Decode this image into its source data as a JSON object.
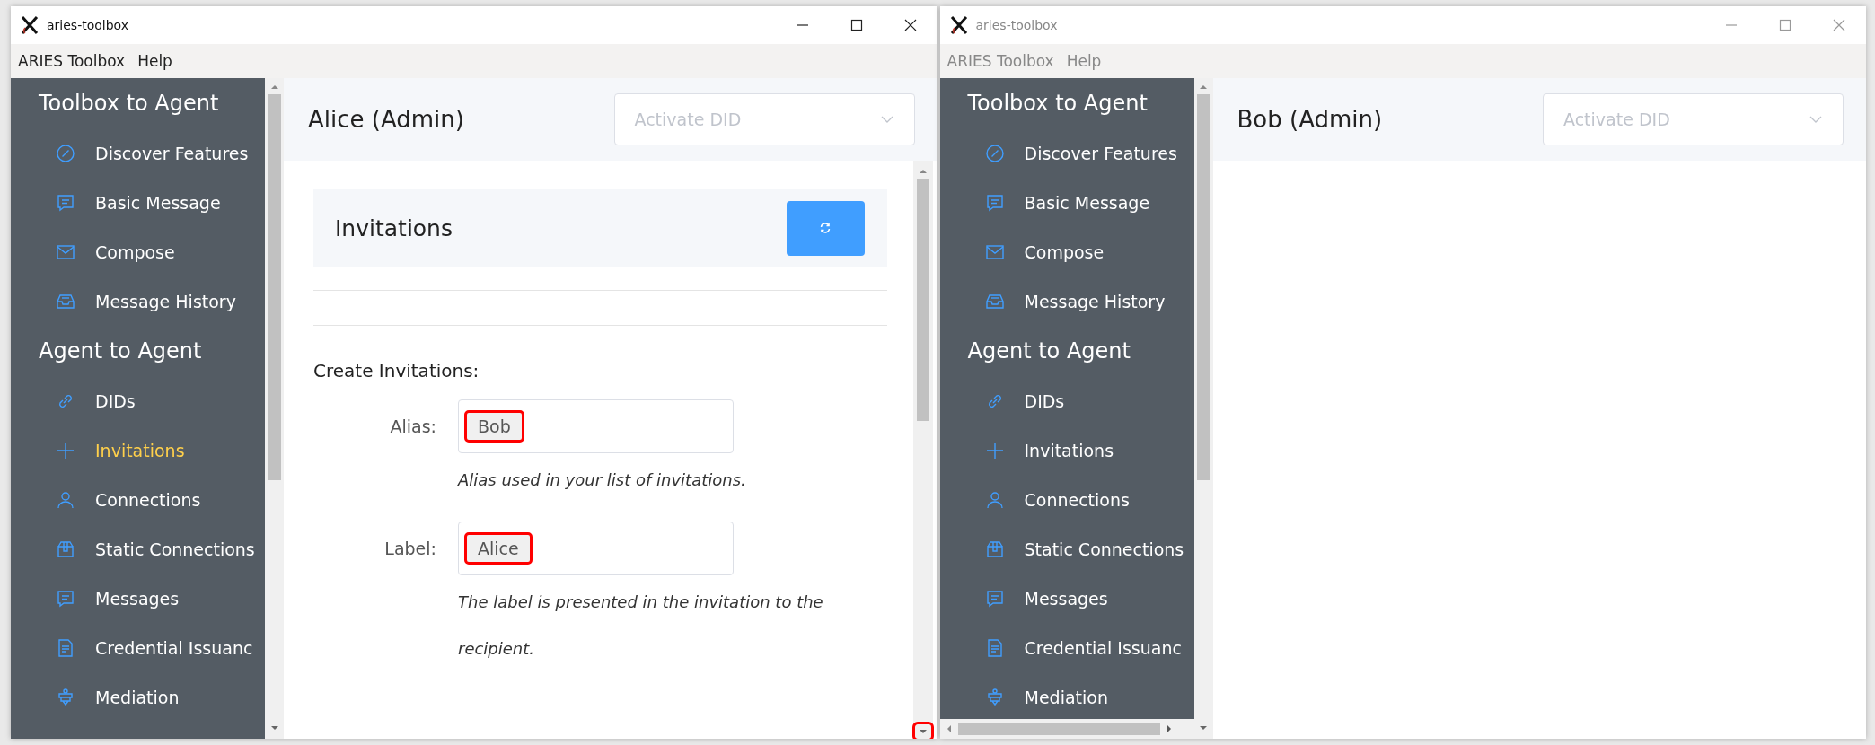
{
  "windows": [
    {
      "title": "aries-toolbox",
      "active": true,
      "menu": [
        "ARIES Toolbox",
        "Help"
      ],
      "horizontal_scrollbar": false,
      "sidebar": [
        {
          "heading": "Toolbox to Agent",
          "items": [
            {
              "label": "Discover Features",
              "kind": "compass",
              "selected": false
            },
            {
              "label": "Basic Message",
              "kind": "message",
              "selected": false
            },
            {
              "label": "Compose",
              "kind": "mail",
              "selected": false
            },
            {
              "label": "Message History",
              "kind": "inbox",
              "selected": false
            }
          ]
        },
        {
          "heading": "Agent to Agent",
          "items": [
            {
              "label": "DIDs",
              "kind": "link",
              "selected": false
            },
            {
              "label": "Invitations",
              "kind": "plus",
              "selected": true
            },
            {
              "label": "Connections",
              "kind": "user",
              "selected": false
            },
            {
              "label": "Static Connections",
              "kind": "box",
              "selected": false
            },
            {
              "label": "Messages",
              "kind": "message",
              "selected": false
            },
            {
              "label": "Credential Issuanc",
              "kind": "document",
              "selected": false
            },
            {
              "label": "Mediation",
              "kind": "mediation",
              "selected": false
            }
          ]
        }
      ],
      "agent": "Alice (Admin)",
      "did_select": {
        "placeholder": "Activate DID"
      },
      "page": {
        "title": "Invitations",
        "section_heading": "Create Invitations:",
        "scroll_arrow_highlighted": true,
        "fields": [
          {
            "label": "Alias:",
            "value": "Bob",
            "help": "Alias used in your list of invitations.",
            "highlighted": true
          },
          {
            "label": "Label:",
            "value": "Alice",
            "help": "The label is presented in the invitation to the recipient.",
            "highlighted": true
          }
        ]
      }
    },
    {
      "title": "aries-toolbox",
      "active": false,
      "menu": [
        "ARIES Toolbox",
        "Help"
      ],
      "horizontal_scrollbar": true,
      "sidebar": [
        {
          "heading": "Toolbox to Agent",
          "items": [
            {
              "label": "Discover Features",
              "kind": "compass",
              "selected": false
            },
            {
              "label": "Basic Message",
              "kind": "message",
              "selected": false
            },
            {
              "label": "Compose",
              "kind": "mail",
              "selected": false
            },
            {
              "label": "Message History",
              "kind": "inbox",
              "selected": false
            }
          ]
        },
        {
          "heading": "Agent to Agent",
          "items": [
            {
              "label": "DIDs",
              "kind": "link",
              "selected": false
            },
            {
              "label": "Invitations",
              "kind": "plus",
              "selected": false
            },
            {
              "label": "Connections",
              "kind": "user",
              "selected": false
            },
            {
              "label": "Static Connections",
              "kind": "box",
              "selected": false
            },
            {
              "label": "Messages",
              "kind": "message",
              "selected": false
            },
            {
              "label": "Credential Issuanc",
              "kind": "document",
              "selected": false
            },
            {
              "label": "Mediation",
              "kind": "mediation",
              "selected": false
            }
          ]
        }
      ],
      "agent": "Bob (Admin)",
      "did_select": {
        "placeholder": "Activate DID"
      }
    }
  ]
}
